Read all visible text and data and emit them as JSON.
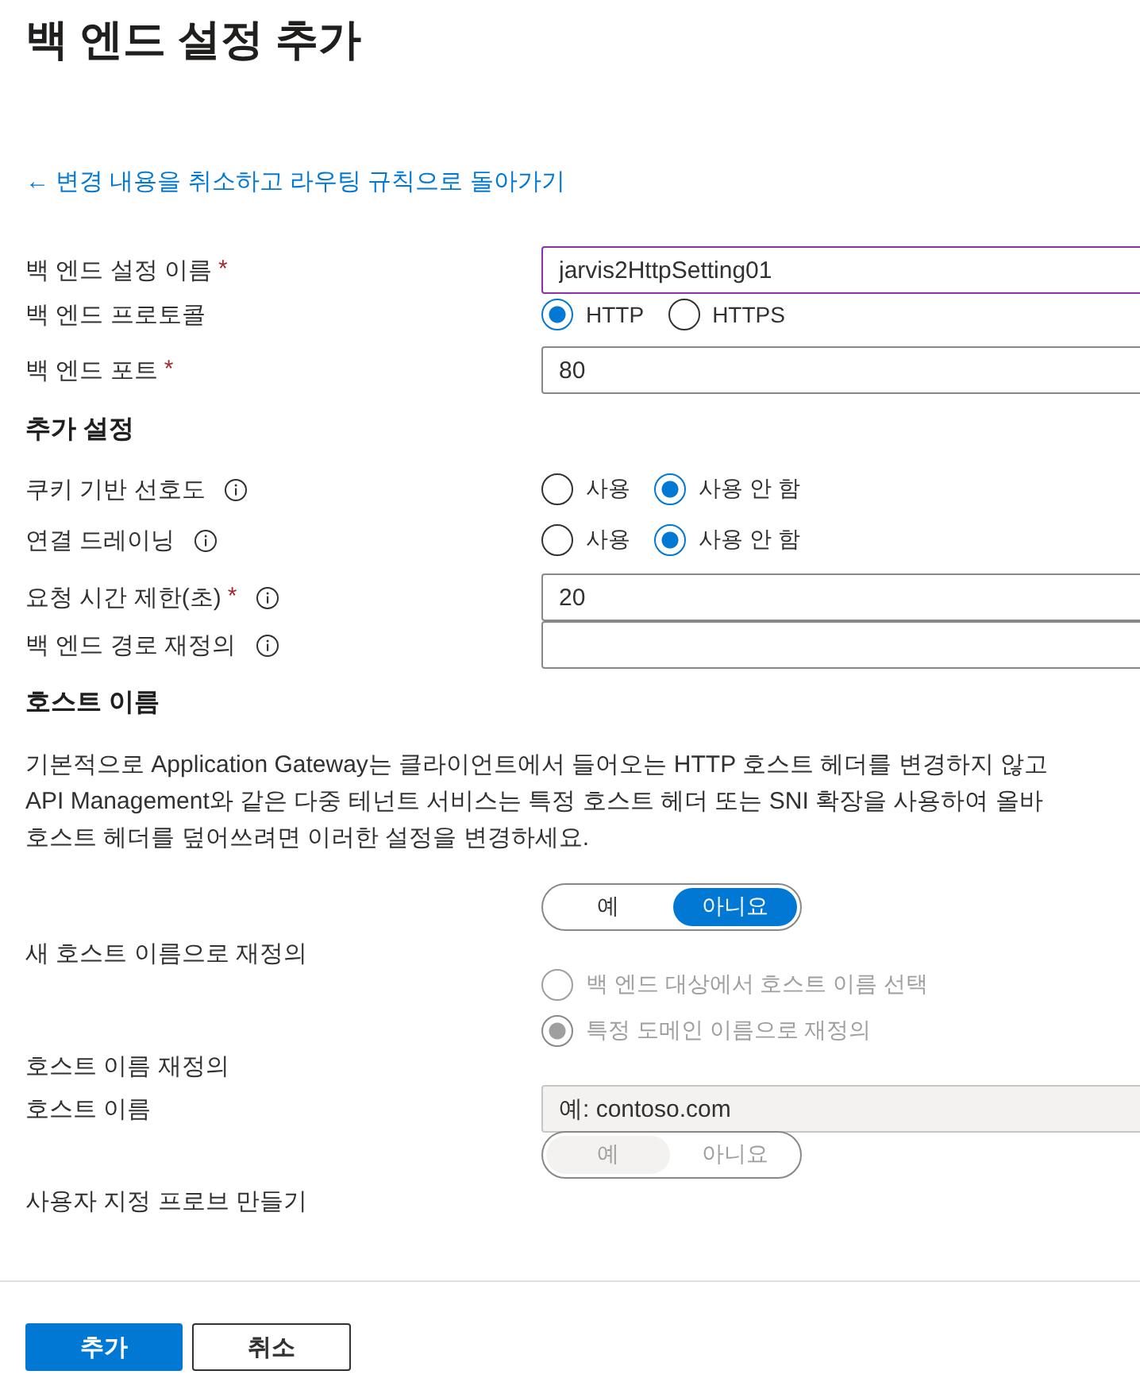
{
  "title": "백 엔드 설정 추가",
  "back_link": {
    "icon": "←",
    "label": "변경 내용을 취소하고 라우팅 규칙으로 돌아가기"
  },
  "rows": [
    {
      "kind": "text",
      "label": "백 엔드 설정 이름",
      "required_mark": "*",
      "value": "jarvis2HttpSetting01",
      "focused": true
    },
    {
      "kind": "radio",
      "label": "백 엔드 프로토콜",
      "options": [
        {
          "label": "HTTP",
          "selected": true
        },
        {
          "label": "HTTPS",
          "selected": false
        }
      ]
    },
    {
      "kind": "text",
      "label": "백 엔드 포트",
      "required_mark": "*",
      "value": "80"
    },
    {
      "kind": "heading",
      "label": "추가 설정"
    },
    {
      "kind": "radio",
      "label": "쿠키 기반 선호도",
      "info": true,
      "options": [
        {
          "label": "사용",
          "selected": false
        },
        {
          "label": "사용 안 함",
          "selected": true
        }
      ]
    },
    {
      "kind": "radio",
      "label": "연결 드레이닝",
      "info": true,
      "options": [
        {
          "label": "사용",
          "selected": false
        },
        {
          "label": "사용 안 함",
          "selected": true
        }
      ]
    },
    {
      "kind": "text",
      "label": "요청 시간 제한(초)",
      "required_mark": "*",
      "info": true,
      "value": "20"
    },
    {
      "kind": "text",
      "label": "백 엔드 경로 재정의",
      "info": true
    },
    {
      "kind": "heading",
      "label": "호스트 이름"
    },
    {
      "kind": "paragraph",
      "lines": [
        "기본적으로 Application Gateway는 클라이언트에서 들어오는 HTTP 호스트 헤더를 변경하지 않고",
        "API Management와 같은 다중 테넌트 서비스는 특정 호스트 헤더 또는 SNI 확장을 사용하여 올바",
        "호스트 헤더를 덮어쓰려면 이러한 설정을 변경하세요."
      ]
    },
    {
      "kind": "toggle",
      "label": "새 호스트 이름으로 재정의",
      "options": [
        {
          "label": "예",
          "selected": false
        },
        {
          "label": "아니요",
          "selected": true
        }
      ]
    },
    {
      "kind": "radio-stack",
      "label": "호스트 이름 재정의",
      "disabled": true,
      "options": [
        {
          "label": "백 엔드 대상에서 호스트 이름 선택",
          "selected": false
        },
        {
          "label": "특정 도메인 이름으로 재정의",
          "selected": true
        }
      ]
    },
    {
      "kind": "text",
      "label": "호스트 이름",
      "placeholder": "예: contoso.com",
      "disabled": true
    },
    {
      "kind": "toggle",
      "label": "사용자 지정 프로브 만들기",
      "disabled": true,
      "options": [
        {
          "label": "예",
          "selected": true
        },
        {
          "label": "아니요",
          "selected": false
        }
      ]
    }
  ],
  "buttons": [
    {
      "label": "추가",
      "primary": true
    },
    {
      "label": "취소",
      "primary": false
    }
  ]
}
